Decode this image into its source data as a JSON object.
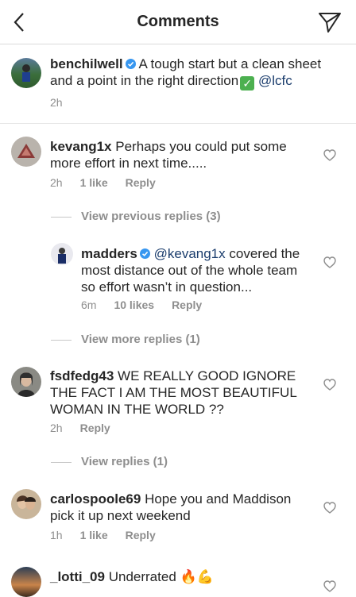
{
  "header": {
    "title": "Comments"
  },
  "caption": {
    "username": "benchilwell",
    "text": "A tough start but a clean sheet and a point in the right direction",
    "emoji": "✓",
    "mention": "@lcfc",
    "time": "2h"
  },
  "comments": [
    {
      "username": "kevang1x",
      "text": "Perhaps you could put some more effort in next time.....",
      "time": "2h",
      "likes": "1 like",
      "reply": "Reply",
      "view_replies": "View previous replies (3)"
    },
    {
      "username": "madders",
      "mention": "@kevang1x",
      "text": "covered the most distance out of the whole team so effort wasn’t in question...",
      "time": "6m",
      "likes": "10 likes",
      "reply": "Reply",
      "view_replies": "View more replies (1)"
    },
    {
      "username": "fsdfedg43",
      "text": "WE REALLY GOOD IGNORE THE FACT I AM THE MOST BEAUTIFUL WOMAN IN THE WORLD ??",
      "time": "2h",
      "reply": "Reply",
      "view_replies": "View replies (1)"
    },
    {
      "username": "carlospoole69",
      "text": "Hope you and Maddison pick it up next weekend",
      "time": "1h",
      "likes": "1 like",
      "reply": "Reply"
    },
    {
      "username": "_lotti_09",
      "text": "Underrated",
      "emoji": "🔥💪"
    }
  ]
}
